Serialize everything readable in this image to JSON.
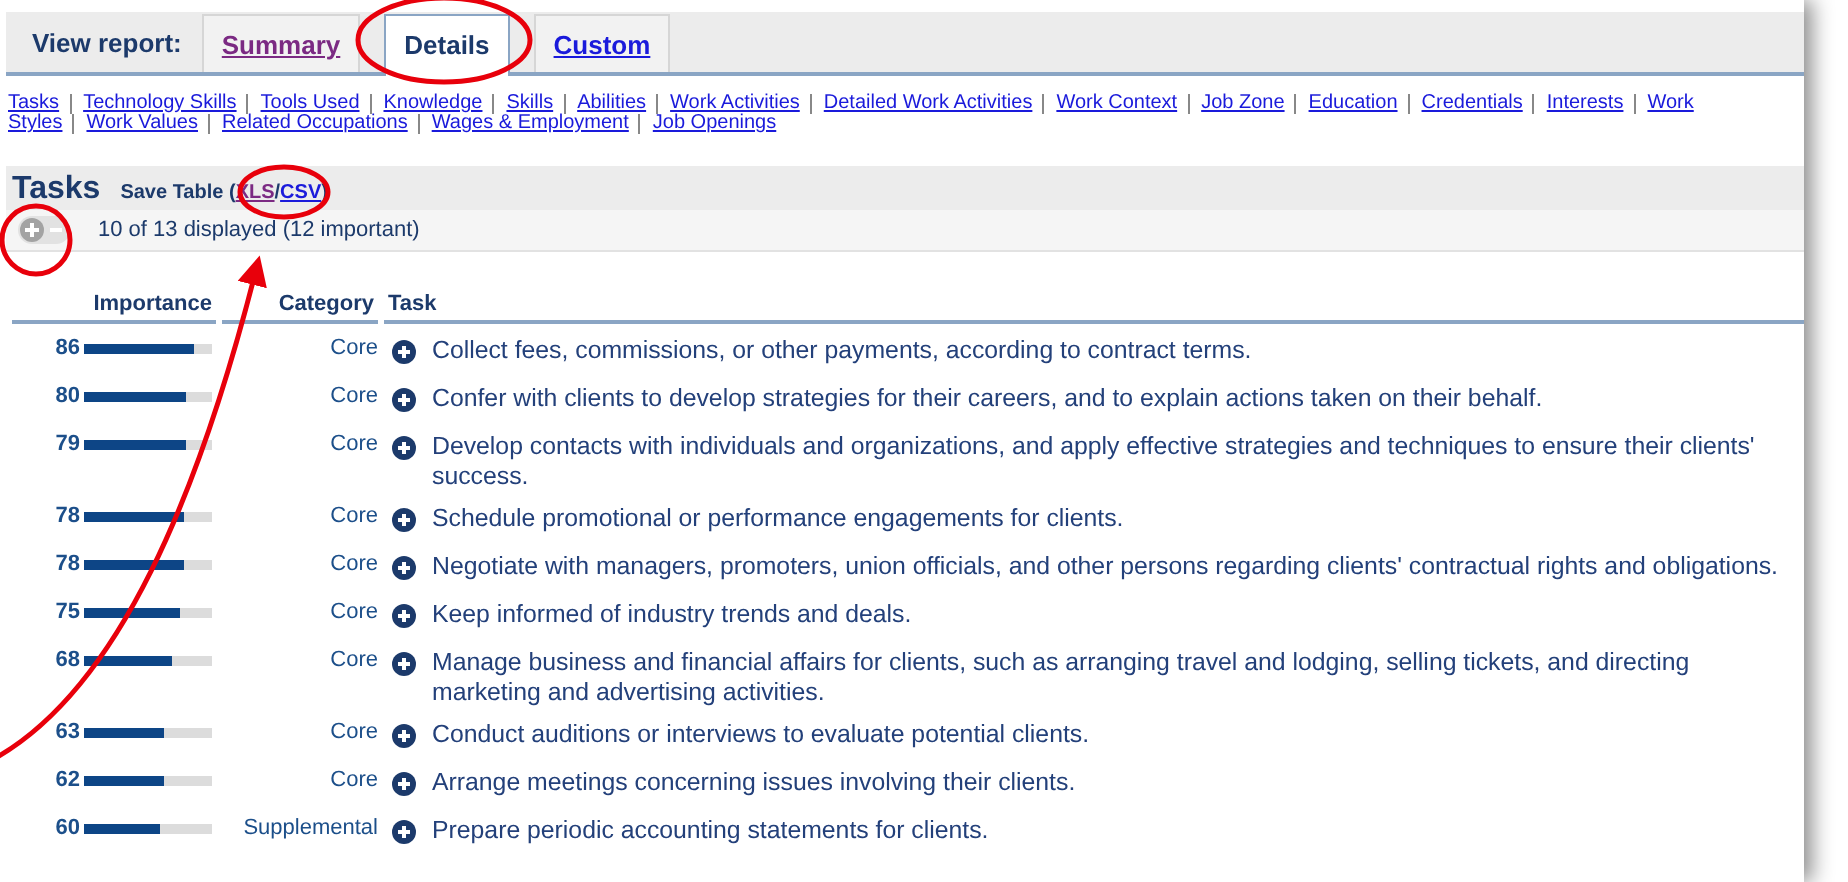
{
  "report_tabs": {
    "label": "View report:",
    "tabs": [
      {
        "label": "Summary",
        "selected": false,
        "visited": true
      },
      {
        "label": "Details",
        "selected": true,
        "visited": false
      },
      {
        "label": "Custom",
        "selected": false,
        "visited": false
      }
    ]
  },
  "nav_links": [
    [
      "Tasks",
      "Technology Skills",
      "Tools Used",
      "Knowledge",
      "Skills",
      "Abilities",
      "Work Activities",
      "Detailed Work Activities",
      "Work Context",
      "Job Zone",
      "Education",
      "Credentials",
      "Interests",
      "Work"
    ],
    [
      "Styles",
      "Work Values",
      "Related Occupations",
      "Wages & Employment",
      "Job Openings"
    ]
  ],
  "section": {
    "title": "Tasks",
    "save_table": {
      "prefix": "Save Table (",
      "links": [
        {
          "label": "XLS",
          "visited": true
        },
        {
          "label": "CSV",
          "visited": false
        }
      ],
      "joiner": "/",
      "suffix": ")"
    },
    "toggle": {
      "can_expand": true,
      "can_collapse": false
    },
    "display_count": "10 of 13 displayed (12 important)"
  },
  "table": {
    "columns": [
      "Importance",
      "Category",
      "Task"
    ],
    "rows": [
      {
        "importance": "86",
        "level": 0.86,
        "category": "Core",
        "task": "Collect fees, commissions, or other payments, according to contract terms."
      },
      {
        "importance": "80",
        "level": 0.8,
        "category": "Core",
        "task": "Confer with clients to develop strategies for their careers, and to explain actions taken on their behalf."
      },
      {
        "importance": "79",
        "level": 0.79,
        "category": "Core",
        "task": "Develop contacts with individuals and organizations, and apply effective strategies and techniques to ensure their clients' success."
      },
      {
        "importance": "78",
        "level": 0.78,
        "category": "Core",
        "task": "Schedule promotional or performance engagements for clients."
      },
      {
        "importance": "78",
        "level": 0.78,
        "category": "Core",
        "task": "Negotiate with managers, promoters, union officials, and other persons regarding clients' contractual rights and obligations."
      },
      {
        "importance": "75",
        "level": 0.75,
        "category": "Core",
        "task": "Keep informed of industry trends and deals."
      },
      {
        "importance": "68",
        "level": 0.68,
        "category": "Core",
        "task": "Manage business and financial affairs for clients, such as arranging travel and lodging, selling tickets, and directing marketing and advertising activities."
      },
      {
        "importance": "63",
        "level": 0.63,
        "category": "Core",
        "task": "Conduct auditions or interviews to evaluate potential clients."
      },
      {
        "importance": "62",
        "level": 0.62,
        "category": "Core",
        "task": "Arrange meetings concerning issues involving their clients."
      },
      {
        "importance": "60",
        "level": 0.6,
        "category": "Supplemental",
        "task": "Prepare periodic accounting statements for clients."
      }
    ]
  }
}
